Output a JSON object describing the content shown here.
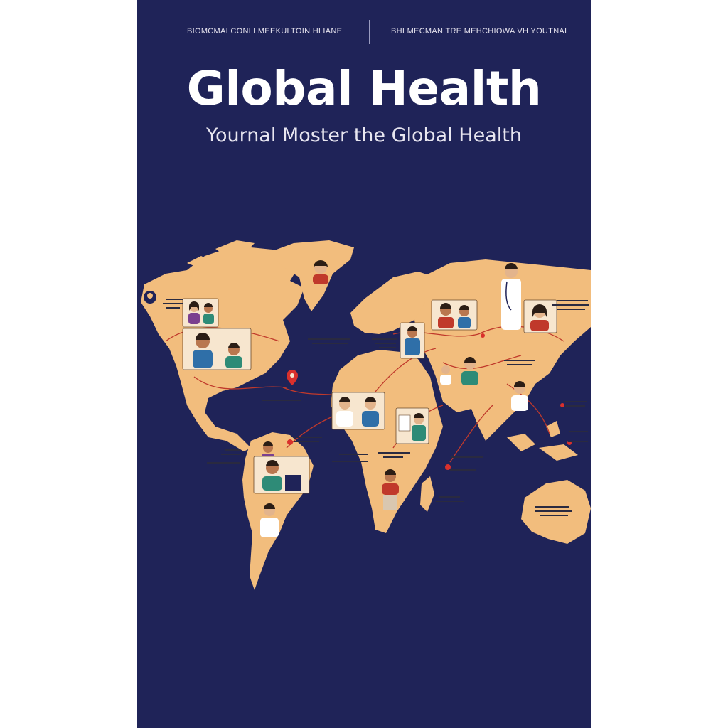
{
  "cover": {
    "header_left": "BIOMCMAI CONLI MEEKULTOIN HLIANE",
    "header_right": "BHI MECMAN TRE MEHCHIOWA VH YOUTNAL",
    "title": "Global Health",
    "subtitle": "Yournal Moster the Global Health"
  },
  "colors": {
    "background": "#1f2358",
    "land": "#f2bd7d",
    "route": "#c0392b",
    "title_text": "#ffffff"
  },
  "map": {
    "icons": [
      "location-pin-icon",
      "doctor-portrait-icon",
      "person-portrait-icon"
    ]
  }
}
